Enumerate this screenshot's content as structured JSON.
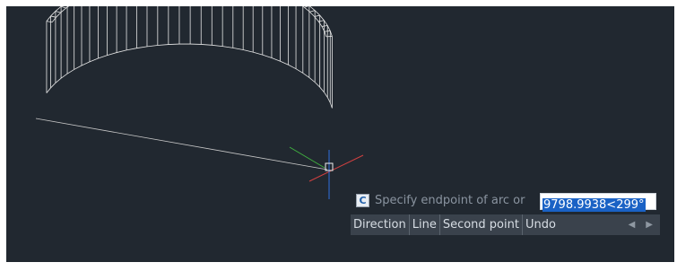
{
  "command": {
    "icon": "command-line-icon",
    "icon_glyph": "C",
    "prompt": "Specify endpoint of arc or",
    "input_value": "9798.9938<299°"
  },
  "options": [
    "Direction",
    "Line",
    "Second point",
    "Undo"
  ],
  "nav": {
    "prev_glyph": "◀",
    "next_glyph": "▶"
  },
  "colors": {
    "viewport_bg": "#212830",
    "wire": "#e6e6e6",
    "axis_x": "#d04040",
    "axis_y": "#40b040",
    "axis_z": "#3070e0"
  }
}
